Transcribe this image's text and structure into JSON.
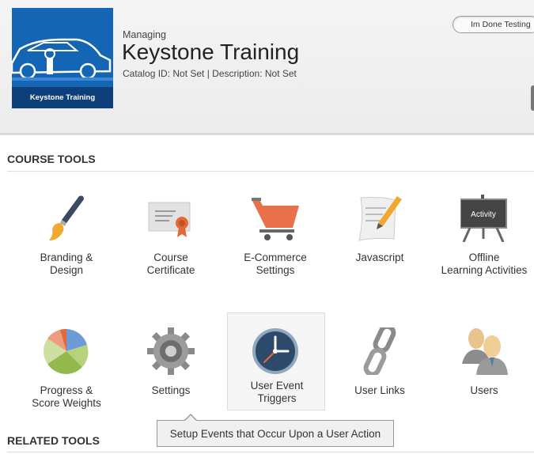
{
  "header": {
    "logo_text": "Keystone Training",
    "managing_label": "Managing",
    "course_name": "Keystone Training",
    "catalog_line": "Catalog ID: Not Set | Description: Not Set",
    "done_button": "Im Done Testing"
  },
  "sections": {
    "course_tools": "COURSE TOOLS",
    "related_tools": "RELATED TOOLS"
  },
  "tools": [
    {
      "label": "Branding &\nDesign",
      "icon": "paintbrush-icon"
    },
    {
      "label": "Course\nCertificate",
      "icon": "certificate-icon"
    },
    {
      "label": "E-Commerce\nSettings",
      "icon": "shopping-cart-icon"
    },
    {
      "label": "Javascript",
      "icon": "script-pencil-icon"
    },
    {
      "label": "Offline\nLearning Activities",
      "icon": "easel-icon",
      "icon_text": "Activity"
    },
    {
      "label": "Progress &\nScore Weights",
      "icon": "pie-chart-icon"
    },
    {
      "label": "Settings",
      "icon": "gear-icon"
    },
    {
      "label": "User Event\nTriggers",
      "icon": "clock-icon"
    },
    {
      "label": "User Links",
      "icon": "chain-link-icon"
    },
    {
      "label": "Users",
      "icon": "users-icon"
    }
  ],
  "tooltip": "Setup Events that Occur Upon a User Action",
  "colors": {
    "logo_blue": "#1565b5",
    "cart_orange": "#e8704a",
    "clock_navy": "#2e4a6b"
  }
}
